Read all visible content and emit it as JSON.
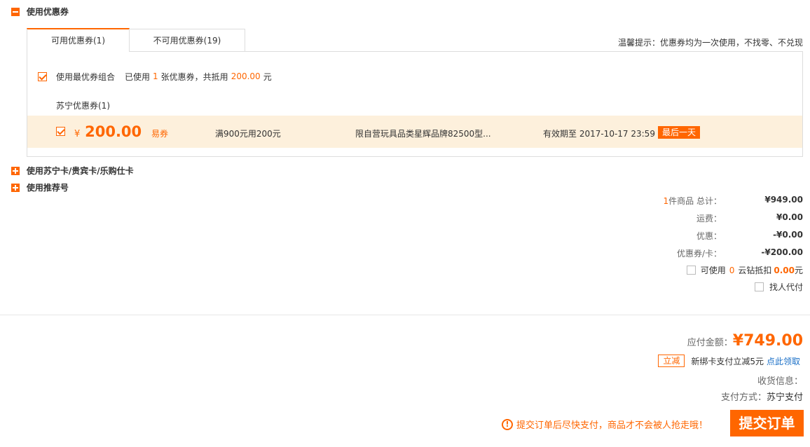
{
  "coupon_section": {
    "title": "使用优惠券",
    "tabs": [
      {
        "label": "可用优惠券(1)",
        "active": true
      },
      {
        "label": "不可用优惠券(19)",
        "active": false
      }
    ],
    "tip": "温馨提示：优惠券均为一次使用，不找零、不兑现",
    "best_combo": {
      "label": "使用最优券组合",
      "used_prefix": "已使用",
      "used_count": "1",
      "used_mid": "张优惠券，共抵用",
      "used_amount": "200.00",
      "used_suffix": "元",
      "checked": true
    },
    "group_title": "苏宁优惠券(1)",
    "coupon": {
      "currency": "¥",
      "amount": "200.00",
      "type": "易券",
      "condition": "满900元用200元",
      "scope": "限自营玩具品类星辉品牌82500型...",
      "valid": "有效期至 2017-10-17 23:59",
      "badge": "最后一天",
      "checked": true
    }
  },
  "card_section": {
    "title": "使用苏宁卡/贵宾卡/乐购仕卡"
  },
  "referral_section": {
    "title": "使用推荐号"
  },
  "summary": {
    "items_count": "1",
    "items_label": "件商品  总计：",
    "total": "¥949.00",
    "shipping_label": "运费：",
    "shipping": "¥0.00",
    "discount_label": "优惠：",
    "discount": "-¥0.00",
    "coupon_label": "优惠券/卡：",
    "coupon": "-¥200.00",
    "cloud_diamond_prefix": "可使用",
    "cloud_diamond_count": "0",
    "cloud_diamond_mid": "云钻抵扣",
    "cloud_diamond_amount": "0.00",
    "cloud_diamond_suffix": "元",
    "find_payer": "找人代付"
  },
  "payment": {
    "payable_label": "应付金额：",
    "payable": "¥749.00",
    "promo_badge": "立减",
    "promo_text": "新绑卡支付立减5元",
    "promo_link": "点此领取",
    "shipping_info_label": "收货信息：",
    "pay_method_label": "支付方式：",
    "pay_method": "苏宁支付",
    "warning": "提交订单后尽快支付，商品才不会被人抢走哦！",
    "submit": "提交订单"
  },
  "colors": {
    "accent": "#ff6600",
    "coupon_row_bg": "#fdf0dc",
    "link": "#1a6fc7"
  }
}
